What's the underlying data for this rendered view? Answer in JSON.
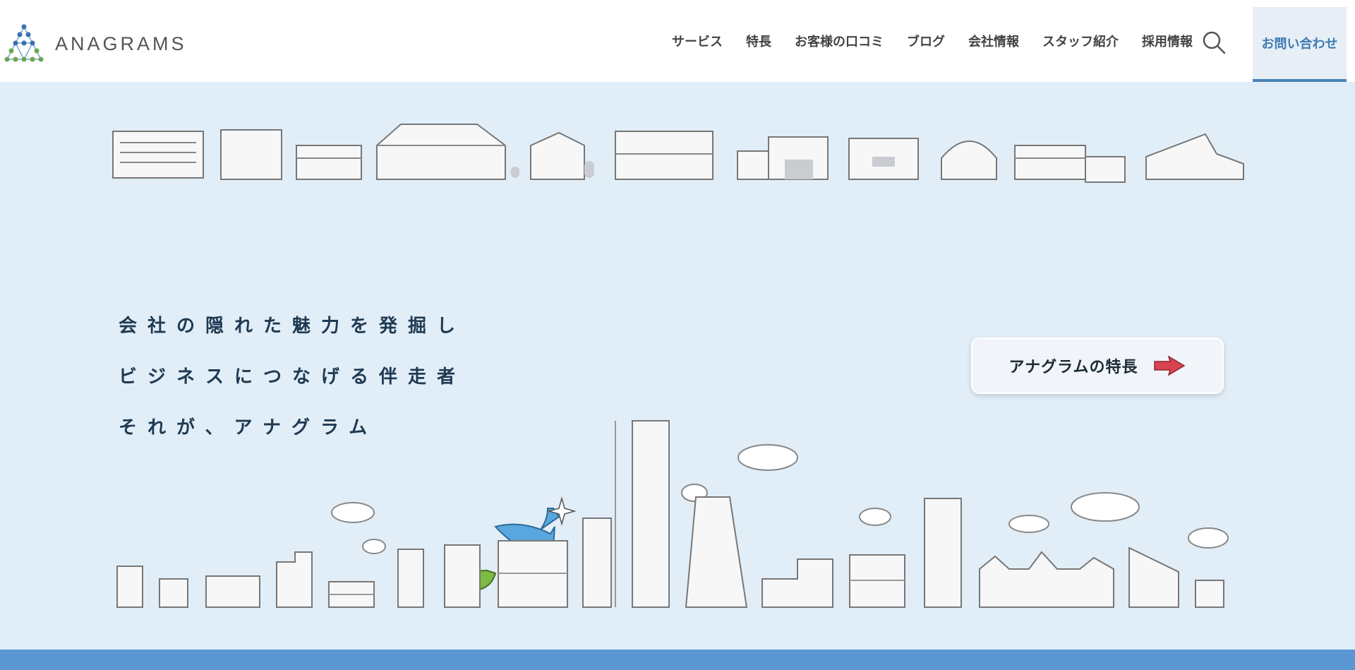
{
  "header": {
    "logo_text": "ANAGRAMS",
    "nav": [
      "サービス",
      "特長",
      "お客様の口コミ",
      "ブログ",
      "会社情報",
      "スタッフ紹介",
      "採用情報"
    ],
    "contact_label": "お問い合わせ"
  },
  "hero": {
    "tagline": [
      "会社の隠れた魅力を発掘し",
      "ビジネスにつなげる伴走者",
      "それが、アナグラム"
    ],
    "feature_button_label": "アナグラムの特長"
  },
  "colors": {
    "header_bg": "#ffffff",
    "hero_bg": "#e1eef8",
    "accent_blue": "#3d7bb5",
    "footer_band": "#5b97d1",
    "arrow_red": "#d9434f",
    "bird_blue": "#5aa6de",
    "bird_green": "#7dbb44"
  },
  "icons": {
    "search": "search-icon",
    "arrow": "arrow-right-icon",
    "logo": "anagrams-logo-icon"
  }
}
